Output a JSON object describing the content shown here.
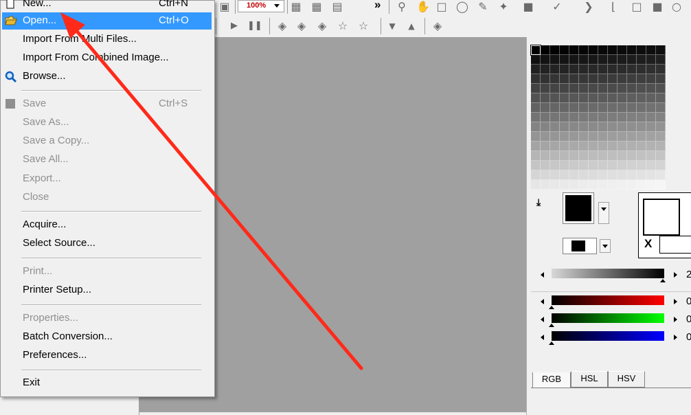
{
  "file_menu": {
    "items": [
      {
        "label": "New...",
        "shortcut": "Ctrl+N",
        "state": "enabled",
        "icon": "new-file-icon"
      },
      {
        "label": "Open...",
        "shortcut": "Ctrl+O",
        "state": "highlighted",
        "icon": "open-folder-icon"
      },
      {
        "label": "Import From Multi Files...",
        "shortcut": "",
        "state": "enabled"
      },
      {
        "label": "Import From Combined Image...",
        "shortcut": "",
        "state": "enabled"
      },
      {
        "label": "Browse...",
        "shortcut": "",
        "state": "enabled",
        "icon": "magnifier-icon"
      },
      {
        "label": "Save",
        "shortcut": "Ctrl+S",
        "state": "disabled",
        "icon": "save-icon"
      },
      {
        "label": "Save As...",
        "shortcut": "",
        "state": "disabled"
      },
      {
        "label": "Save a Copy...",
        "shortcut": "",
        "state": "disabled"
      },
      {
        "label": "Save All...",
        "shortcut": "",
        "state": "disabled"
      },
      {
        "label": "Export...",
        "shortcut": "",
        "state": "disabled"
      },
      {
        "label": "Close",
        "shortcut": "",
        "state": "disabled"
      },
      {
        "label": "Acquire...",
        "shortcut": "",
        "state": "enabled"
      },
      {
        "label": "Select Source...",
        "shortcut": "",
        "state": "enabled"
      },
      {
        "label": "Print...",
        "shortcut": "",
        "state": "disabled"
      },
      {
        "label": "Printer Setup...",
        "shortcut": "",
        "state": "enabled"
      },
      {
        "label": "Properties...",
        "shortcut": "",
        "state": "disabled"
      },
      {
        "label": "Batch Conversion...",
        "shortcut": "",
        "state": "enabled"
      },
      {
        "label": "Preferences...",
        "shortcut": "",
        "state": "enabled"
      },
      {
        "label": "Exit",
        "shortcut": "",
        "state": "enabled"
      }
    ]
  },
  "toolbar": {
    "zoom_value": "100%",
    "overflow_label": "»"
  },
  "color_panel": {
    "swatch_mode_x": "X",
    "gray_slider_value": "2",
    "rgb_values": {
      "red": "0",
      "green": "0",
      "blue": "0"
    },
    "tabs": [
      "RGB",
      "HSL",
      "HSV"
    ],
    "active_tab": "RGB",
    "colors": {
      "red_channel": "#ff0000",
      "green_channel": "#00ff00",
      "blue_channel": "#0000ff",
      "menu_highlight": "#3399ff",
      "canvas_background": "#a0a0a0",
      "annotation_arrow": "#ff2a1a"
    }
  }
}
